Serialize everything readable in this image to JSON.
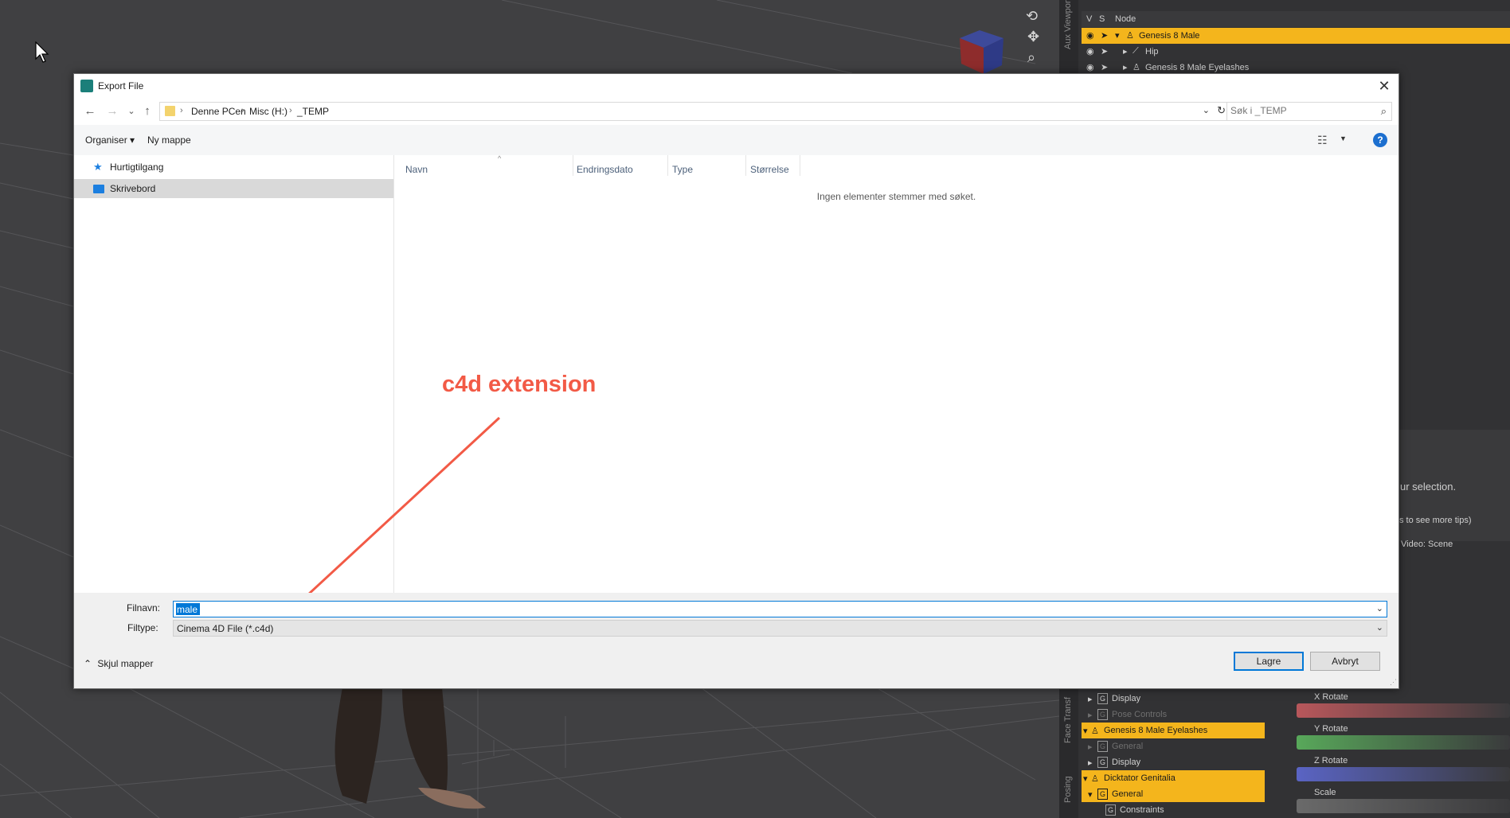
{
  "dialog": {
    "title": "Export File",
    "close_glyph": "✕",
    "nav": {
      "back_glyph": "←",
      "forward_glyph": "→",
      "recent_glyph": "⌄",
      "up_glyph": "↑"
    },
    "breadcrumbs": [
      "Denne PCen",
      "Misc (H:)",
      "_TEMP"
    ],
    "breadcrumb_separator": "›",
    "search_placeholder": "Søk i _TEMP",
    "toolbar": {
      "organize_label": "Organiser ▾",
      "new_folder_label": "Ny mappe",
      "help_glyph": "?"
    },
    "sidebar": {
      "items": [
        {
          "label": "Hurtigtilgang",
          "icon": "pin-icon",
          "color": "#1c7fe0"
        },
        {
          "label": "Skrivebord",
          "icon": "desktop-icon",
          "color": "#1c7fe0"
        }
      ]
    },
    "columns": [
      "Navn",
      "Endringsdato",
      "Type",
      "Størrelse"
    ],
    "empty_message": "Ingen elementer stemmer med søket.",
    "filename_label": "Filnavn:",
    "filename_value": "male",
    "filetype_label": "Filtype:",
    "filetype_value": "Cinema 4D File (*.c4d)",
    "hide_folders_label": "Skjul mapper",
    "save_label": "Lagre",
    "cancel_label": "Avbryt"
  },
  "annotation": {
    "text": "c4d extension",
    "color": "#f25a46"
  },
  "scene": {
    "header": {
      "v": "V",
      "s": "S",
      "node": "Node"
    },
    "side_tab": "Aux Viewport",
    "nodes": [
      {
        "label": "Genesis 8 Male",
        "selected": true
      },
      {
        "label": "Hip",
        "selected": false
      },
      {
        "label": "Genesis 8 Male Eyelashes",
        "selected": false
      }
    ]
  },
  "tips": {
    "line1": "ur selection.",
    "line2": "s to see more tips)",
    "line3": "Video: Scene"
  },
  "parameters": {
    "side_tabs": [
      "Face Transf",
      "Posing"
    ],
    "rows": [
      {
        "label": "Display",
        "kind": "group",
        "selected": false,
        "dim": false
      },
      {
        "label": "Pose Controls",
        "kind": "group",
        "selected": false,
        "dim": true
      },
      {
        "label": "Genesis 8 Male Eyelashes",
        "kind": "figure",
        "selected": true,
        "dim": false
      },
      {
        "label": "General",
        "kind": "group",
        "selected": false,
        "dim": true
      },
      {
        "label": "Display",
        "kind": "group",
        "selected": false,
        "dim": false
      },
      {
        "label": "Dicktator Genitalia",
        "kind": "figure",
        "selected": true,
        "dim": false
      },
      {
        "label": "General",
        "kind": "group",
        "selected": true,
        "dim": false
      },
      {
        "label": "Constraints",
        "kind": "group",
        "selected": false,
        "dim": false
      }
    ],
    "sliders": [
      {
        "label": "X Rotate",
        "color": "#b8575b"
      },
      {
        "label": "Y Rotate",
        "color": "#58a85a"
      },
      {
        "label": "Z Rotate",
        "color": "#5a64c4"
      },
      {
        "label": "Scale",
        "color": "#6a6a6a"
      }
    ]
  }
}
